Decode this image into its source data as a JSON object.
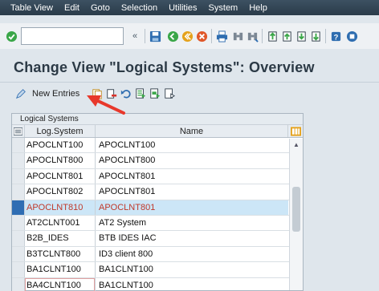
{
  "menubar": {
    "items": [
      "Table View",
      "Edit",
      "Goto",
      "Selection",
      "Utilities",
      "System",
      "Help"
    ]
  },
  "toolbar": {
    "command_field_value": "",
    "icons": [
      "check-icon",
      "double-chevron-icon",
      "save-icon",
      "back-icon",
      "exit-icon",
      "cancel-icon",
      "print-icon",
      "find-icon",
      "find-next-icon",
      "first-page-icon",
      "prev-page-icon",
      "next-page-icon",
      "last-page-icon",
      "help-icon",
      "layout-icon"
    ]
  },
  "page": {
    "title": "Change View \"Logical Systems\": Overview"
  },
  "app_toolbar": {
    "new_entries_label": "New Entries",
    "icons": [
      "copy-as-icon",
      "delete-icon",
      "undo-icon",
      "select-all-icon",
      "select-block-icon",
      "deselect-all-icon"
    ]
  },
  "table": {
    "caption": "Logical Systems",
    "columns": [
      "Log.System",
      "Name"
    ],
    "rows": [
      {
        "log_system": "APOCLNT100",
        "name": "APOCLNT100"
      },
      {
        "log_system": "APOCLNT800",
        "name": "APOCLNT800"
      },
      {
        "log_system": "APOCLNT801",
        "name": "APOCLNT801"
      },
      {
        "log_system": "APOCLNT802",
        "name": "APOCLNT801"
      },
      {
        "log_system": "APOCLNT810",
        "name": "APOCLNT801"
      },
      {
        "log_system": "AT2CLNT001",
        "name": "AT2 System"
      },
      {
        "log_system": "B2B_IDES",
        "name": "BTB IDES IAC"
      },
      {
        "log_system": "B3TCLNT800",
        "name": "ID3 client  800"
      },
      {
        "log_system": "BA1CLNT100",
        "name": "BA1CLNT100"
      },
      {
        "log_system": "BA4CLNT100",
        "name": "BA1CLNT100"
      }
    ],
    "selected_row_index": 4
  },
  "colors": {
    "menubar_bg": "#2f4252",
    "selected_row_bg": "#cce6f7",
    "selected_text": "#c0392b",
    "annotation_arrow": "#e8382b"
  }
}
